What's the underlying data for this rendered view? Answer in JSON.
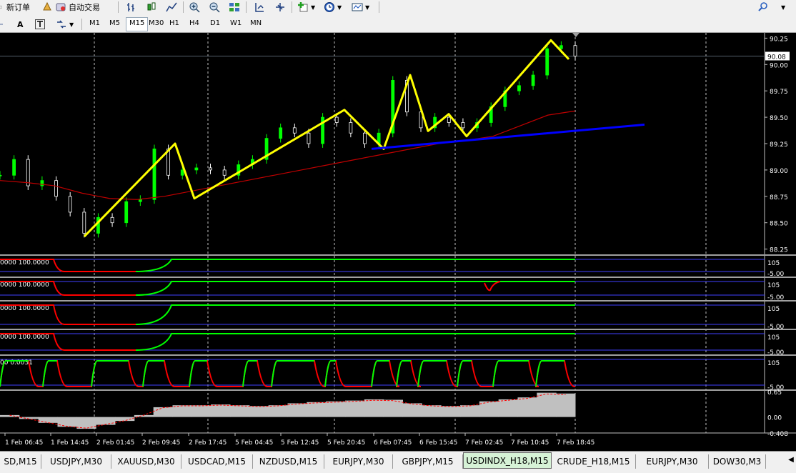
{
  "toolbar1": {
    "new_order_label": "新订单",
    "autotrade_label": "自动交易"
  },
  "toolbar2": {
    "text_tool_label": "A",
    "timeframes": [
      "M1",
      "M5",
      "M15",
      "M30",
      "H1",
      "H4",
      "D1",
      "W1",
      "MN"
    ],
    "active_timeframe": "M15"
  },
  "chart_data": {
    "type": "line",
    "symbol": "USDINDX_H18",
    "timeframe": "M15",
    "price_axis": {
      "ticks": [
        "90.25",
        "90.00",
        "89.75",
        "89.50",
        "89.25",
        "89.00",
        "88.75",
        "88.50",
        "88.25"
      ],
      "current_price": "90.08",
      "ylim": [
        88.2,
        90.3
      ]
    },
    "time_axis": [
      "1 Feb 06:45",
      "1 Feb 14:45",
      "2 Feb 01:45",
      "2 Feb 09:45",
      "2 Feb 17:45",
      "5 Feb 04:45",
      "5 Feb 12:45",
      "5 Feb 20:45",
      "6 Feb 07:45",
      "6 Feb 15:45",
      "7 Feb 02:45",
      "7 Feb 10:45",
      "7 Feb 18:45"
    ],
    "zigzag": [
      {
        "x": "1 Feb 14:45",
        "y": 88.37
      },
      {
        "x": "2 Feb 09:45",
        "y": 89.25
      },
      {
        "x": "2 Feb 17:45",
        "y": 88.73
      },
      {
        "x": "5 Feb 20:45",
        "y": 89.57
      },
      {
        "x": "6 Feb 07:45",
        "y": 89.2
      },
      {
        "x": "6 Feb 15:45",
        "y": 89.9
      },
      {
        "x": "6 Feb 15:45",
        "y": 89.37
      },
      {
        "x": "7 Feb 02:45",
        "y": 89.53
      },
      {
        "x": "7 Feb 02:45",
        "y": 89.32
      },
      {
        "x": "7 Feb 18:45",
        "y": 90.23
      },
      {
        "x": "7 Feb 18:45",
        "y": 90.05
      }
    ],
    "trendline": [
      {
        "x": "6 Feb 07:45",
        "y": 89.2
      },
      {
        "x": "7 Feb 18:45",
        "y": 89.43
      }
    ],
    "moving_average": [
      88.9,
      88.88,
      88.85,
      88.78,
      88.73,
      88.72,
      88.75,
      88.8,
      88.85,
      88.9,
      88.95,
      89.0,
      89.05,
      89.1,
      89.15,
      89.2,
      89.25,
      89.28,
      89.32,
      89.42,
      89.52,
      89.56
    ],
    "price_series": [
      88.95,
      89.1,
      88.85,
      88.9,
      88.75,
      88.6,
      88.4,
      88.55,
      88.5,
      88.7,
      88.72,
      89.2,
      88.95,
      89.0,
      89.02,
      89.0,
      88.95,
      89.05,
      89.1,
      89.3,
      89.4,
      89.35,
      89.25,
      89.5,
      89.45,
      89.35,
      89.25,
      89.35,
      89.85,
      89.55,
      89.4,
      89.5,
      89.45,
      89.4,
      89.45,
      89.6,
      89.75,
      89.8,
      89.9,
      90.15,
      90.18,
      90.08
    ],
    "sub_windows": [
      {
        "label": "0000 100.0000",
        "axis_top": "105",
        "axis_bottom": "-5.00"
      },
      {
        "label": "0000 100.0000",
        "axis_top": "105",
        "axis_bottom": "-5.00"
      },
      {
        "label": "0000 100.0000",
        "axis_top": "105",
        "axis_bottom": "-5.00"
      },
      {
        "label": "0000 100.0000",
        "axis_top": "105",
        "axis_bottom": "-5.00"
      },
      {
        "label": "00 0.0031",
        "axis_top": "105",
        "axis_bottom": "-5.00"
      },
      {
        "label": "",
        "axis_ticks": [
          "0.65",
          "0.00",
          "-0.408"
        ]
      }
    ],
    "colors": {
      "zigzag": "#ffff00",
      "trendline": "#0000ff",
      "moving_average": "#c00000",
      "up": "#00ff00",
      "down": "#ff0000",
      "histogram": "#c0c0c0"
    }
  },
  "tabs": [
    "SD,M15",
    "USDJPY,M30",
    "XAUUSD,M30",
    "USDCAD,M15",
    "NZDUSD,M15",
    "EURJPY,M30",
    "GBPJPY,M15",
    "USDINDX_H18,M15",
    "CRUDE_H18,M15",
    "EURJPY,M30",
    "DOW30,M3"
  ],
  "active_tab": "USDINDX_H18,M15"
}
